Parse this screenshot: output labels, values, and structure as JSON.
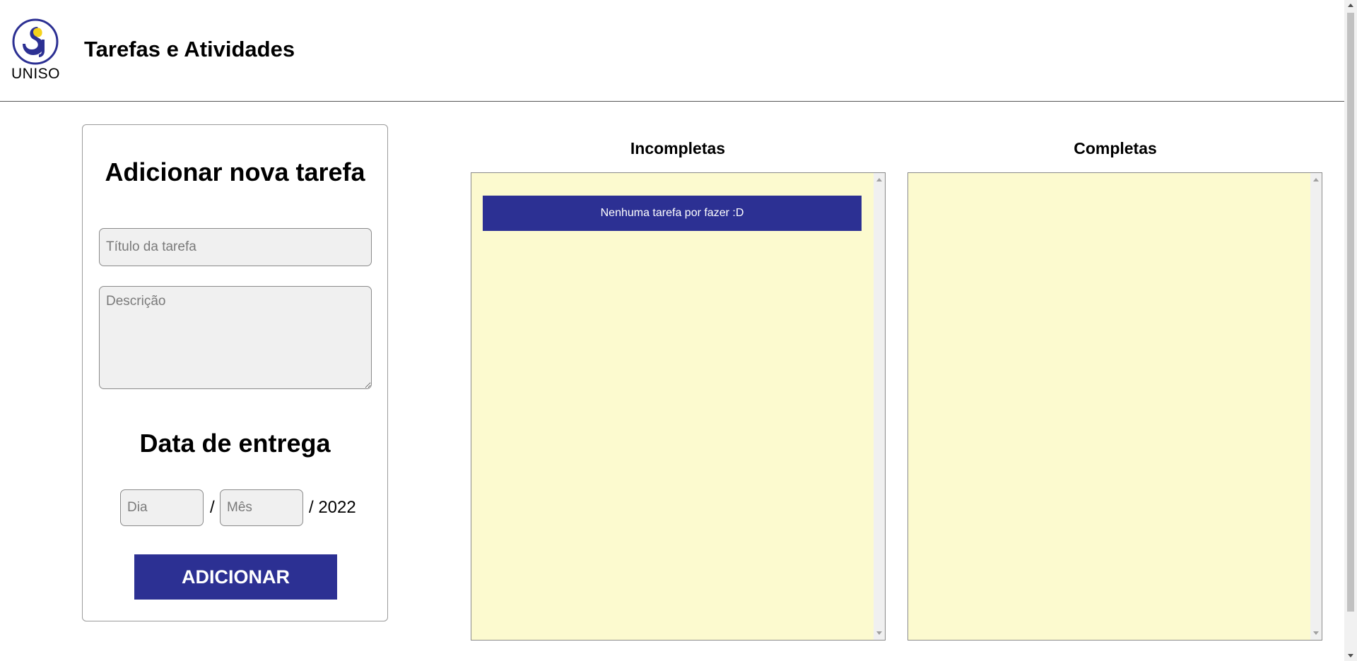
{
  "header": {
    "logo_text": "UNISO",
    "title": "Tarefas e Atividades"
  },
  "form": {
    "heading": "Adicionar nova tarefa",
    "title_placeholder": "Título da tarefa",
    "description_placeholder": "Descrição",
    "date_heading": "Data de entrega",
    "day_placeholder": "Dia",
    "separator": "/",
    "month_placeholder": "Mês",
    "year_suffix": "/ 2022",
    "add_button_label": "ADICIONAR"
  },
  "columns": {
    "incomplete": {
      "heading": "Incompletas",
      "empty_message": "Nenhuma tarefa por fazer :D"
    },
    "complete": {
      "heading": "Completas"
    }
  },
  "colors": {
    "brand_blue": "#2c3093",
    "list_background": "#fcfacf",
    "input_background": "#f0f0f0"
  },
  "icons": {
    "logo": "uniso-logo-icon"
  }
}
